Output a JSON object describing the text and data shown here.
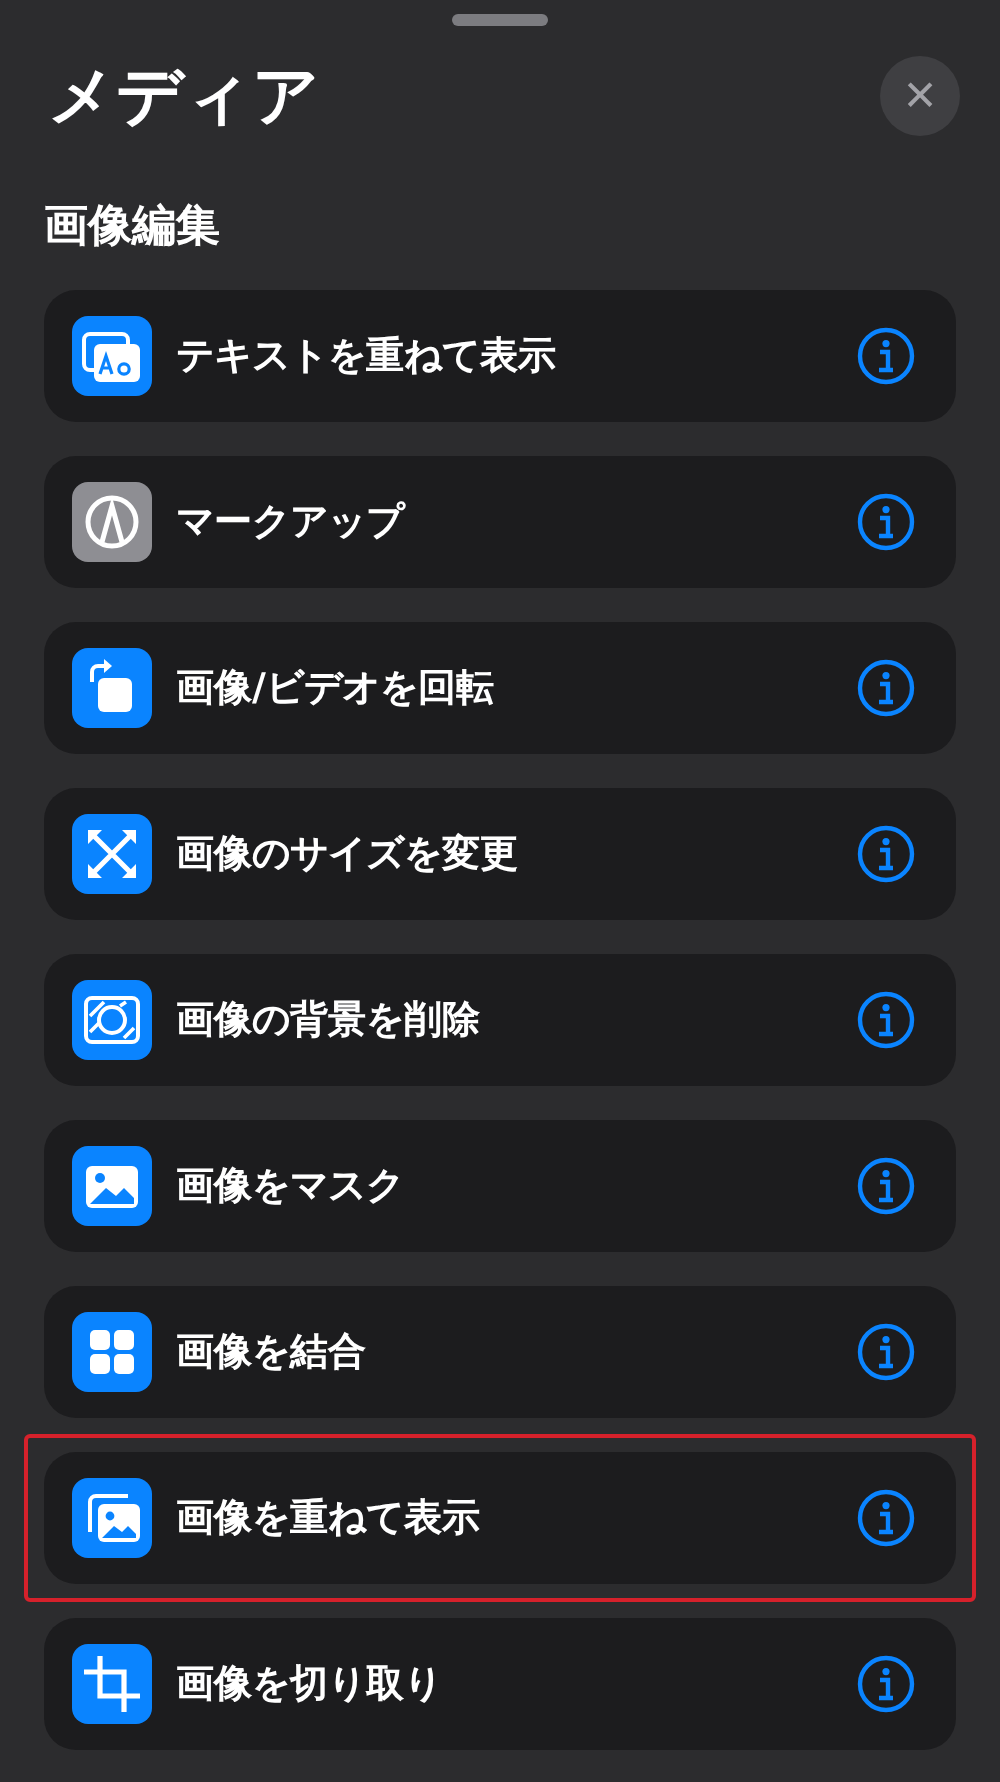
{
  "sheet": {
    "title": "メディア",
    "close_label": "✕"
  },
  "section": {
    "title": "画像編集"
  },
  "actions": [
    {
      "label": "テキストを重ねて表示",
      "kind": "text-overlay",
      "color": "#0a84ff",
      "highlighted": false
    },
    {
      "label": "マークアップ",
      "kind": "markup",
      "color": "#8e8e93",
      "highlighted": false
    },
    {
      "label": "画像/ビデオを回転",
      "kind": "rotate",
      "color": "#0a84ff",
      "highlighted": false
    },
    {
      "label": "画像のサイズを変更",
      "kind": "resize",
      "color": "#0a84ff",
      "highlighted": false
    },
    {
      "label": "画像の背景を削除",
      "kind": "remove-background",
      "color": "#0a84ff",
      "highlighted": false
    },
    {
      "label": "画像をマスク",
      "kind": "mask",
      "color": "#0a84ff",
      "highlighted": false
    },
    {
      "label": "画像を結合",
      "kind": "combine",
      "color": "#0a84ff",
      "highlighted": false
    },
    {
      "label": "画像を重ねて表示",
      "kind": "overlay",
      "color": "#0a84ff",
      "highlighted": true
    },
    {
      "label": "画像を切り取り",
      "kind": "crop",
      "color": "#0a84ff",
      "highlighted": false
    }
  ]
}
